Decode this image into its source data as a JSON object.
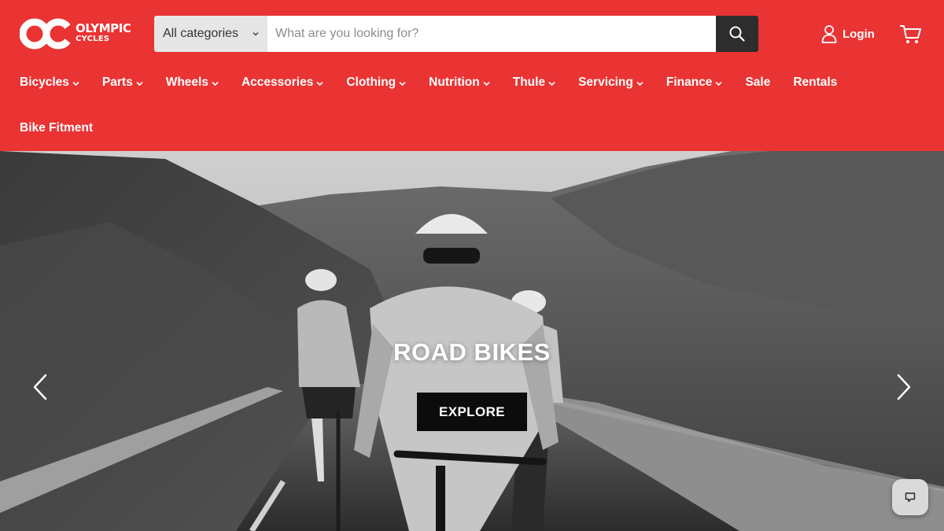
{
  "brand": {
    "name_line1": "OLYMPIC",
    "name_line2": "CYCLES",
    "color": "#ea3333"
  },
  "search": {
    "category": "All categories",
    "placeholder": "What are you looking for?",
    "button_icon": "search-icon"
  },
  "account": {
    "login_label": "Login",
    "login_icon": "user-icon",
    "cart_icon": "cart-icon"
  },
  "nav": {
    "row1": [
      {
        "label": "Bicycles",
        "dropdown": true
      },
      {
        "label": "Parts",
        "dropdown": true
      },
      {
        "label": "Wheels",
        "dropdown": true
      },
      {
        "label": "Accessories",
        "dropdown": true
      },
      {
        "label": "Clothing",
        "dropdown": true
      },
      {
        "label": "Nutrition",
        "dropdown": true
      },
      {
        "label": "Thule",
        "dropdown": true
      },
      {
        "label": "Servicing",
        "dropdown": true
      },
      {
        "label": "Finance",
        "dropdown": true
      },
      {
        "label": "Sale",
        "dropdown": false
      },
      {
        "label": "Rentals",
        "dropdown": false
      }
    ],
    "row2": [
      {
        "label": "Bike Fitment",
        "dropdown": false
      }
    ]
  },
  "hero": {
    "title": "ROAD BIKES",
    "cta_label": "EXPLORE",
    "prev_icon": "chevron-left-icon",
    "next_icon": "chevron-right-icon"
  },
  "chat": {
    "icon": "chat-bubble-icon"
  }
}
